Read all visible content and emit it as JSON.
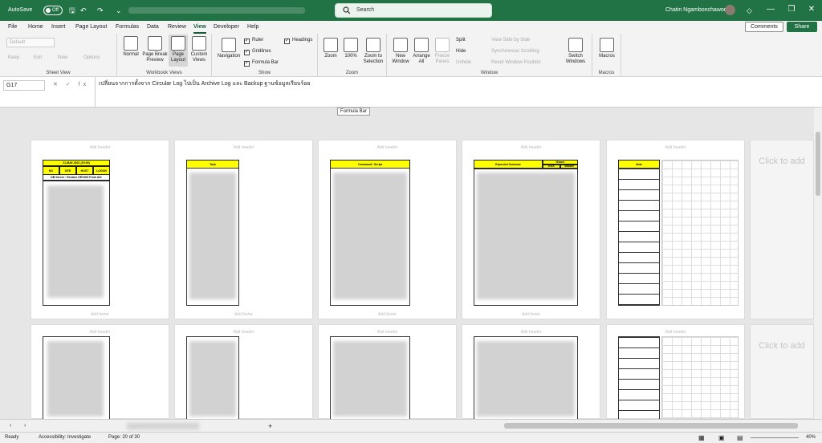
{
  "titlebar": {
    "autosave_label": "AutoSave",
    "autosave_state": "Off",
    "search_placeholder": "Search",
    "user_name": "Chatin Ngambonchawong",
    "min": "—",
    "max": "❐",
    "close": "✕"
  },
  "menu": {
    "tabs": [
      "File",
      "Home",
      "Insert",
      "Page Layout",
      "Formulas",
      "Data",
      "Review",
      "View",
      "Developer",
      "Help"
    ],
    "active": "View",
    "comments": "Comments",
    "share": "Share"
  },
  "ribbon": {
    "sheet_view": {
      "dropdown": "Default",
      "keep": "Keep",
      "exit": "Exit",
      "new": "New",
      "options": "Options",
      "label": "Sheet View"
    },
    "workbook_views": {
      "normal": "Normal",
      "page_break": "Page Break Preview",
      "page_layout": "Page Layout",
      "custom": "Custom Views",
      "label": "Workbook Views"
    },
    "show": {
      "ruler": "Ruler",
      "gridlines": "Gridlines",
      "formula_bar": "Formula Bar",
      "headings": "Headings",
      "navigation": "Navigation",
      "label": "Show"
    },
    "zoom": {
      "zoom": "Zoom",
      "hundred": "100%",
      "zoom_selection": "Zoom to Selection",
      "label": "Zoom"
    },
    "window": {
      "new_window": "New Window",
      "arrange_all": "Arrange All",
      "freeze": "Freeze Panes",
      "split": "Split",
      "hide": "Hide",
      "unhide": "Unhide",
      "side_by_side": "View Side by Side",
      "sync_scroll": "Synchronous Scrolling",
      "reset_pos": "Reset Window Position",
      "switch": "Switch Windows",
      "label": "Window"
    },
    "macros": {
      "macros": "Macros",
      "label": "Macros"
    }
  },
  "formula_bar": {
    "name_box": "G17",
    "fx": "✕ ✓ fx",
    "content": "เปลี่ยนจากการตั้งจาก Circular Log ไปเป็น Archive Log และ Backup ฐานข้อมูลเรียบร้อย",
    "tooltip": "Formula Bar"
  },
  "pages": {
    "add_header": "Add header",
    "add_footer": "Add footer",
    "click_to_add": "Click to add",
    "p1_date": "21-MAY-2021 (19:00)",
    "p1_cols": [
      "NO",
      "SITE",
      "HOST",
      "LOGON"
    ],
    "p1_sub": "DB Server : Restore DEV000 From AIX",
    "p2_head": "Task",
    "p3_head": "Command / Script",
    "p4_head": "Expected Outcome",
    "p4_sub_head": "Owner",
    "p4_sub_cols": [
      "EGX",
      "Vendor"
    ],
    "p5_head": "Note"
  },
  "sheet_tabs": {
    "add": "+"
  },
  "statusbar": {
    "ready": "Ready",
    "accessibility": "Accessibility: Investigate",
    "page": "Page: 20 of 30",
    "zoom": "40%"
  }
}
